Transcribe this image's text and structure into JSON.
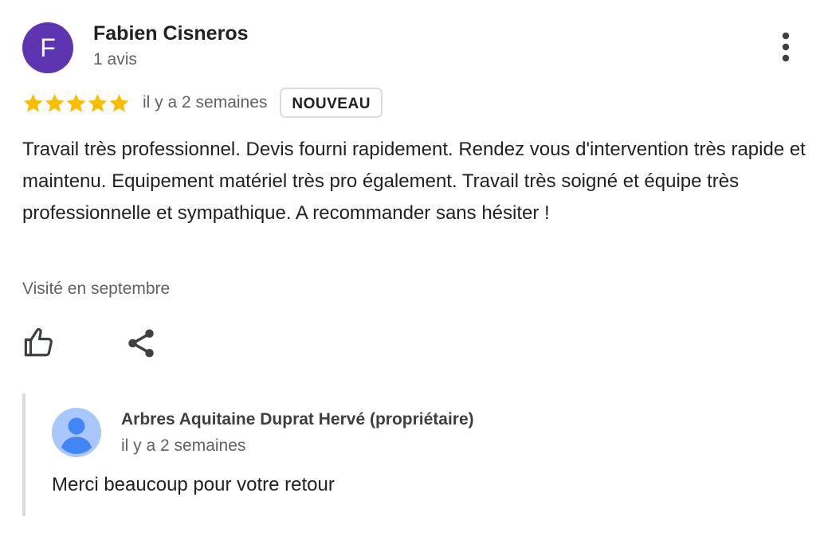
{
  "review": {
    "avatar_initial": "F",
    "avatar_color": "#5e35b1",
    "author_name": "Fabien Cisneros",
    "author_meta": "1 avis",
    "rating": 5,
    "rating_max": 5,
    "star_color": "#fbbc04",
    "date": "il y a 2 semaines",
    "badge": "NOUVEAU",
    "text": "Travail très professionnel. Devis fourni rapidement. Rendez vous d'intervention très rapide et maintenu. Equipement matériel très pro également. Travail très soigné et équipe très professionnelle et sympathique. A recommander sans hésiter !",
    "visit": "Visité en septembre",
    "icons": {
      "more": "more-vert-icon",
      "like": "thumb-up-icon",
      "share": "share-icon"
    }
  },
  "owner_reply": {
    "name": "Arbres Aquitaine Duprat Hervé (propriétaire)",
    "date": "il y a 2 semaines",
    "text": "Merci beaucoup pour votre retour",
    "avatar_icon": "default-profile-icon"
  }
}
